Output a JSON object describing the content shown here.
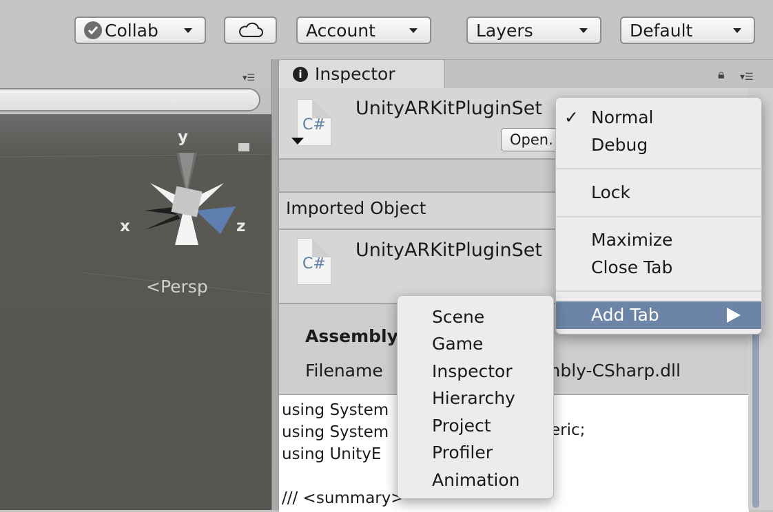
{
  "toolbar": {
    "collab_label": "Collab",
    "account_label": "Account",
    "layers_label": "Layers",
    "layout_label": "Default"
  },
  "scene": {
    "axis_y": "y",
    "axis_x": "x",
    "axis_z": "z",
    "projection_label": "Persp"
  },
  "inspector": {
    "tab_label": "Inspector",
    "asset_name": "UnityARKitPluginSet",
    "open_button_label": "Open.",
    "cs_label": "C#",
    "imported_object_label": "Imported Object",
    "imported_name": "UnityARKitPluginSet",
    "assembly_label": "Assembly",
    "filename_label": "Filename",
    "filename_value": "mbly-CSharp.dll",
    "code_lines": [
      "using System",
      "using System",
      "using UnityE",
      "",
      "/// <summary>"
    ],
    "code_line2_suffix": "eric;"
  },
  "context_menu": {
    "checkmark": "✓",
    "normal": "Normal",
    "debug": "Debug",
    "lock": "Lock",
    "maximize": "Maximize",
    "close_tab": "Close Tab",
    "add_tab": "Add Tab",
    "highlight_color": "#6b84a8"
  },
  "add_tab_submenu": {
    "items": [
      "Scene",
      "Game",
      "Inspector",
      "Hierarchy",
      "Project",
      "Profiler",
      "Animation"
    ]
  }
}
